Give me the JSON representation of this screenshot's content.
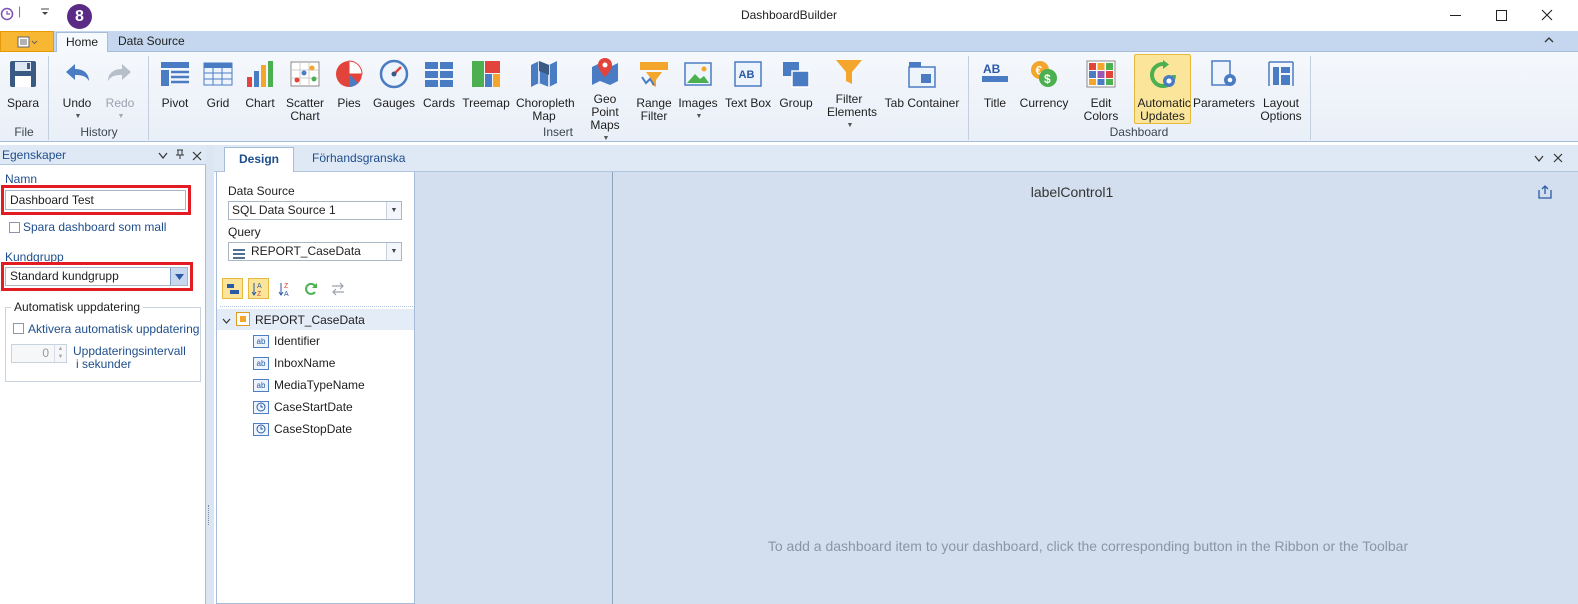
{
  "window": {
    "title": "DashboardBuilder",
    "badge": "8"
  },
  "ribbon_tabs": [
    "Home",
    "Data Source"
  ],
  "ribbon": {
    "file": {
      "label": "File",
      "save": "Spara"
    },
    "history": {
      "label": "History",
      "undo": "Undo",
      "redo": "Redo"
    },
    "insert": {
      "label": "Insert",
      "items": [
        "Pivot",
        "Grid",
        "Chart",
        "Scatter Chart",
        "Pies",
        "Gauges",
        "Cards",
        "Treemap",
        "Choropleth Map",
        "Geo Point Maps",
        "Range Filter",
        "Images",
        "Text Box",
        "Group",
        "Filter Elements",
        "Tab Container"
      ]
    },
    "dashboard": {
      "label": "Dashboard",
      "items": [
        "Title",
        "Currency",
        "Edit Colors",
        "Automatic Updates",
        "Parameters",
        "Layout Options"
      ]
    }
  },
  "properties": {
    "header": "Egenskaper",
    "name_label": "Namn",
    "name_value": "Dashboard Test",
    "save_template": "Spara dashboard som mall",
    "group_label": "Kundgrupp",
    "group_value": "Standard kundgrupp",
    "auto_update_title": "Automatisk uppdatering",
    "auto_update_enable": "Aktivera automatisk uppdatering",
    "interval_value": "0",
    "interval_label_1": "Uppdateringsintervall",
    "interval_label_2": "i sekunder"
  },
  "doc_tabs": [
    "Design",
    "Förhandsgranska"
  ],
  "datasource": {
    "ds_label": "Data Source",
    "ds_value": "SQL Data Source 1",
    "query_label": "Query",
    "query_value": "REPORT_CaseData",
    "tree_root": "REPORT_CaseData",
    "fields": [
      {
        "name": "Identifier",
        "icon": "ab"
      },
      {
        "name": "InboxName",
        "icon": "ab"
      },
      {
        "name": "MediaTypeName",
        "icon": "ab"
      },
      {
        "name": "CaseStartDate",
        "icon": "clock"
      },
      {
        "name": "CaseStopDate",
        "icon": "clock"
      }
    ]
  },
  "canvas": {
    "label": "labelControl1",
    "hint": "To add a dashboard item to your dashboard, click the corresponding button in the Ribbon or the Toolbar"
  },
  "colors": {
    "accent_blue": "#2a5aa7",
    "highlight": "#fbe59b",
    "red_box": "#e31b23",
    "orange": "#f7b733"
  }
}
